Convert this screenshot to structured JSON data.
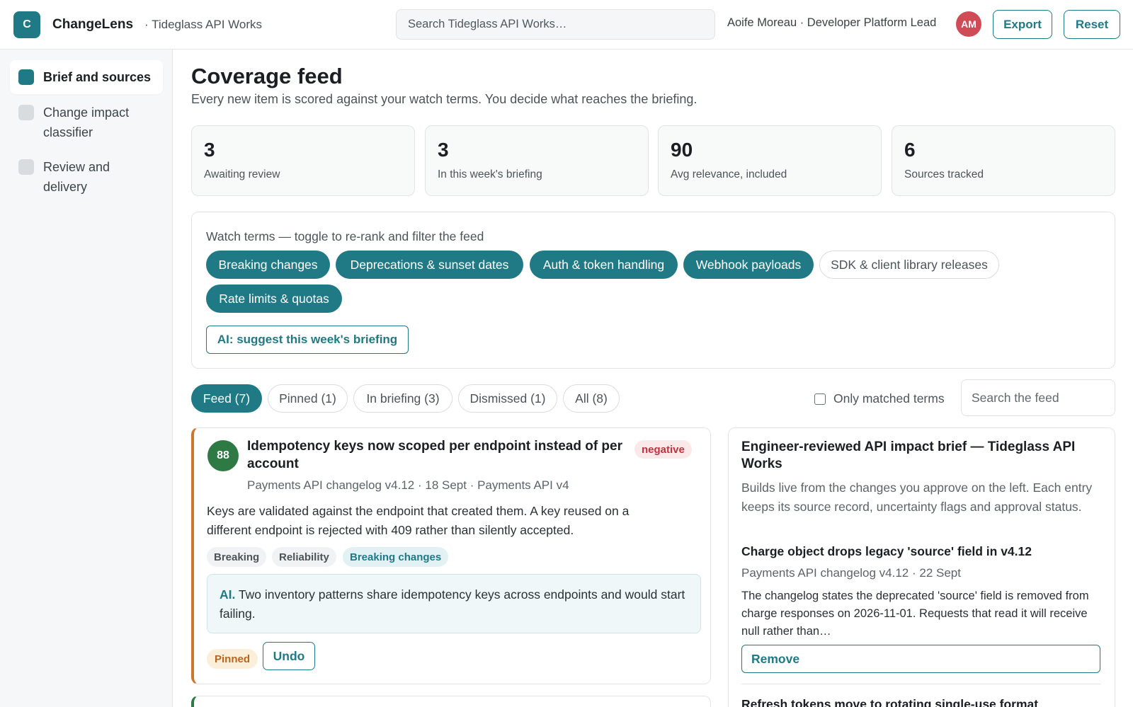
{
  "header": {
    "logo_letter": "C",
    "app_name": "ChangeLens",
    "workspace": "· Tideglass API Works",
    "search_placeholder": "Search Tideglass API Works…",
    "user": "Aoife Moreau · Developer Platform Lead",
    "avatar_initials": "AM",
    "export_label": "Export",
    "reset_label": "Reset"
  },
  "sidebar": {
    "items": [
      {
        "label": "Brief and sources",
        "active": true
      },
      {
        "label": "Change impact classifier",
        "active": false
      },
      {
        "label": "Review and delivery",
        "active": false
      }
    ]
  },
  "main": {
    "title": "Coverage feed",
    "subtitle": "Every new item is scored against your watch terms. You decide what reaches the briefing.",
    "stats": [
      {
        "value": "3",
        "label": "Awaiting review"
      },
      {
        "value": "3",
        "label": "In this week's briefing"
      },
      {
        "value": "90",
        "label": "Avg relevance, included"
      },
      {
        "value": "6",
        "label": "Sources tracked"
      }
    ],
    "watch": {
      "label": "Watch terms — toggle to re-rank and filter the feed",
      "terms": [
        {
          "label": "Breaking changes",
          "on": true
        },
        {
          "label": "Deprecations & sunset dates",
          "on": true
        },
        {
          "label": "Auth & token handling",
          "on": true
        },
        {
          "label": "Webhook payloads",
          "on": true
        },
        {
          "label": "SDK & client library releases",
          "on": false
        },
        {
          "label": "Rate limits & quotas",
          "on": true
        }
      ],
      "ai_button": "AI: suggest this week's briefing"
    },
    "tabs": [
      {
        "label": "Feed (7)",
        "active": true
      },
      {
        "label": "Pinned (1)",
        "active": false
      },
      {
        "label": "In briefing (3)",
        "active": false
      },
      {
        "label": "Dismissed (1)",
        "active": false
      },
      {
        "label": "All (8)",
        "active": false
      }
    ],
    "only_matched_label": "Only matched terms",
    "only_matched_checked": false,
    "feed_search_placeholder": "Search the feed"
  },
  "feed_card": {
    "score": "88",
    "title": "Idempotency keys now scoped per endpoint instead of per account",
    "sentiment": "negative",
    "meta": "Payments API changelog v4.12 · 18 Sept · Payments API v4",
    "body": "Keys are validated against the endpoint that created them. A key reused on a different endpoint is rejected with 409 rather than silently accepted.",
    "tags": [
      "Breaking",
      "Reliability",
      "Breaking changes"
    ],
    "ai_prefix": "AI.",
    "ai_text": "Two inventory patterns share idempotency keys across endpoints and would start failing.",
    "status": "Pinned",
    "undo_label": "Undo"
  },
  "brief": {
    "title": "Engineer-reviewed API impact brief — Tideglass API Works",
    "description": "Builds live from the changes you approve on the left. Each entry keeps its source record, uncertainty flags and approval status.",
    "entries": [
      {
        "title": "Charge object drops legacy 'source' field in v4.12",
        "meta": "Payments API changelog v4.12 · 22 Sept",
        "body": "The changelog states the deprecated 'source' field is removed from charge responses on 2026-11-01. Requests that read it will receive null rather than…",
        "remove_label": "Remove"
      },
      {
        "title": "Refresh tokens move to rotating single-use format"
      }
    ]
  },
  "colors": {
    "accent": "#1f7a86",
    "score_green": "#2f7a44",
    "negative": "#c0323f",
    "pinned": "#b7651f",
    "avatar": "#d14b57"
  }
}
